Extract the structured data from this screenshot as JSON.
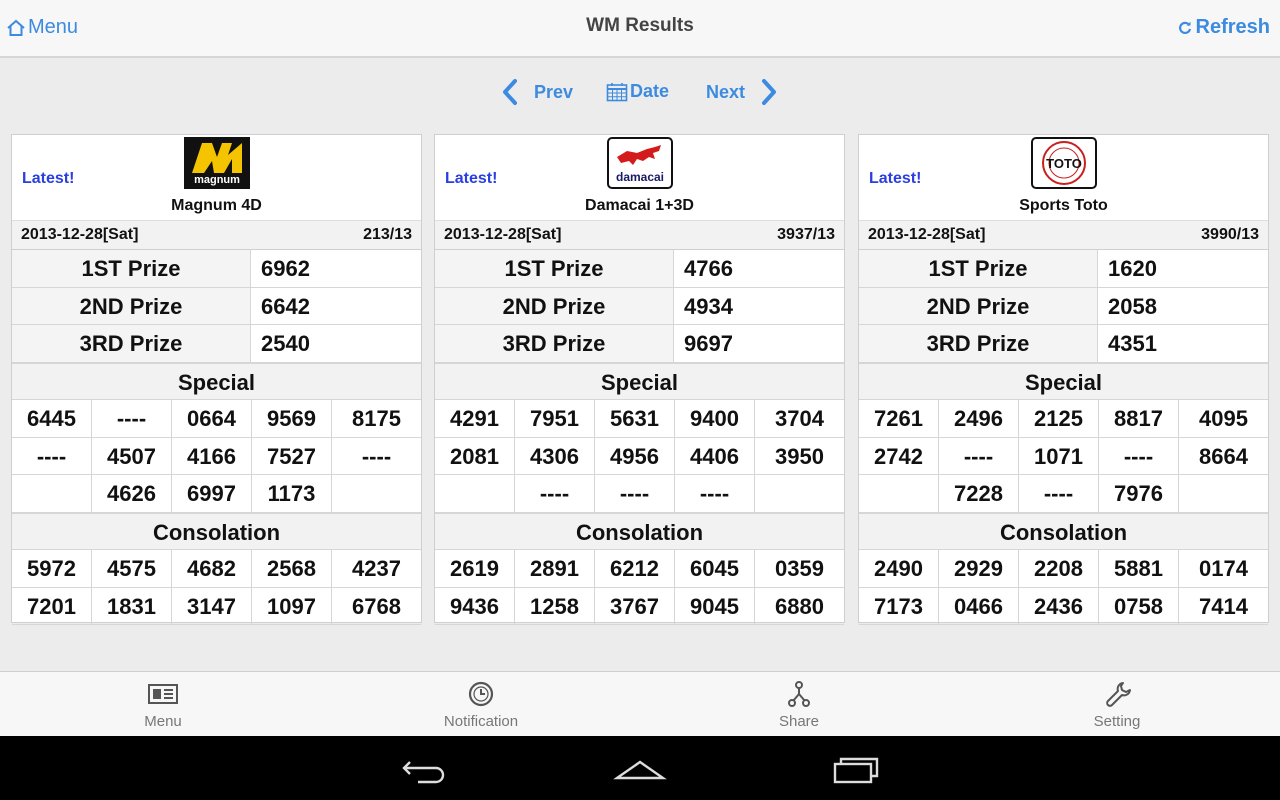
{
  "topbar": {
    "menu_label": "Menu",
    "menu_icon": "home-icon",
    "title": "WM Results",
    "refresh_label": "Refresh",
    "refresh_icon": "refresh-icon"
  },
  "nav": {
    "prev_label": "Prev",
    "date_label": "Date",
    "next_label": "Next"
  },
  "colors": {
    "accent": "#3c8be0",
    "latest": "#2a3fe0"
  },
  "cards": [
    {
      "latest": "Latest!",
      "logo_text": "magnum",
      "name": "Magnum 4D",
      "date": "2013-12-28[Sat]",
      "draw_no": "213/13",
      "prizes": [
        {
          "label": "1ST Prize",
          "value": "6962"
        },
        {
          "label": "2ND Prize",
          "value": "6642"
        },
        {
          "label": "3RD Prize",
          "value": "2540"
        }
      ],
      "special_label": "Special",
      "special": [
        [
          "6445",
          "----",
          "0664",
          "9569",
          "8175"
        ],
        [
          "----",
          "4507",
          "4166",
          "7527",
          "----"
        ],
        [
          "",
          "4626",
          "6997",
          "1173",
          ""
        ]
      ],
      "consolation_label": "Consolation",
      "consolation": [
        [
          "5972",
          "4575",
          "4682",
          "2568",
          "4237"
        ],
        [
          "7201",
          "1831",
          "3147",
          "1097",
          "6768"
        ]
      ]
    },
    {
      "latest": "Latest!",
      "logo_text": "damacai",
      "name": "Damacai 1+3D",
      "date": "2013-12-28[Sat]",
      "draw_no": "3937/13",
      "prizes": [
        {
          "label": "1ST Prize",
          "value": "4766"
        },
        {
          "label": "2ND Prize",
          "value": "4934"
        },
        {
          "label": "3RD Prize",
          "value": "9697"
        }
      ],
      "special_label": "Special",
      "special": [
        [
          "4291",
          "7951",
          "5631",
          "9400",
          "3704"
        ],
        [
          "2081",
          "4306",
          "4956",
          "4406",
          "3950"
        ],
        [
          "",
          "----",
          "----",
          "----",
          ""
        ]
      ],
      "consolation_label": "Consolation",
      "consolation": [
        [
          "2619",
          "2891",
          "6212",
          "6045",
          "0359"
        ],
        [
          "9436",
          "1258",
          "3767",
          "9045",
          "6880"
        ]
      ]
    },
    {
      "latest": "Latest!",
      "logo_text": "TOTO",
      "name": "Sports Toto",
      "date": "2013-12-28[Sat]",
      "draw_no": "3990/13",
      "prizes": [
        {
          "label": "1ST Prize",
          "value": "1620"
        },
        {
          "label": "2ND Prize",
          "value": "2058"
        },
        {
          "label": "3RD Prize",
          "value": "4351"
        }
      ],
      "special_label": "Special",
      "special": [
        [
          "7261",
          "2496",
          "2125",
          "8817",
          "4095"
        ],
        [
          "2742",
          "----",
          "1071",
          "----",
          "8664"
        ],
        [
          "",
          "7228",
          "----",
          "7976",
          ""
        ]
      ],
      "consolation_label": "Consolation",
      "consolation": [
        [
          "2490",
          "2929",
          "2208",
          "5881",
          "0174"
        ],
        [
          "7173",
          "0466",
          "2436",
          "0758",
          "7414"
        ]
      ]
    }
  ],
  "tabs": [
    {
      "label": "Menu",
      "icon": "newspaper-icon"
    },
    {
      "label": "Notification",
      "icon": "clock-icon"
    },
    {
      "label": "Share",
      "icon": "share-icon"
    },
    {
      "label": "Setting",
      "icon": "wrench-icon"
    }
  ],
  "system_nav": [
    "back-icon",
    "home-icon",
    "recent-apps-icon"
  ]
}
